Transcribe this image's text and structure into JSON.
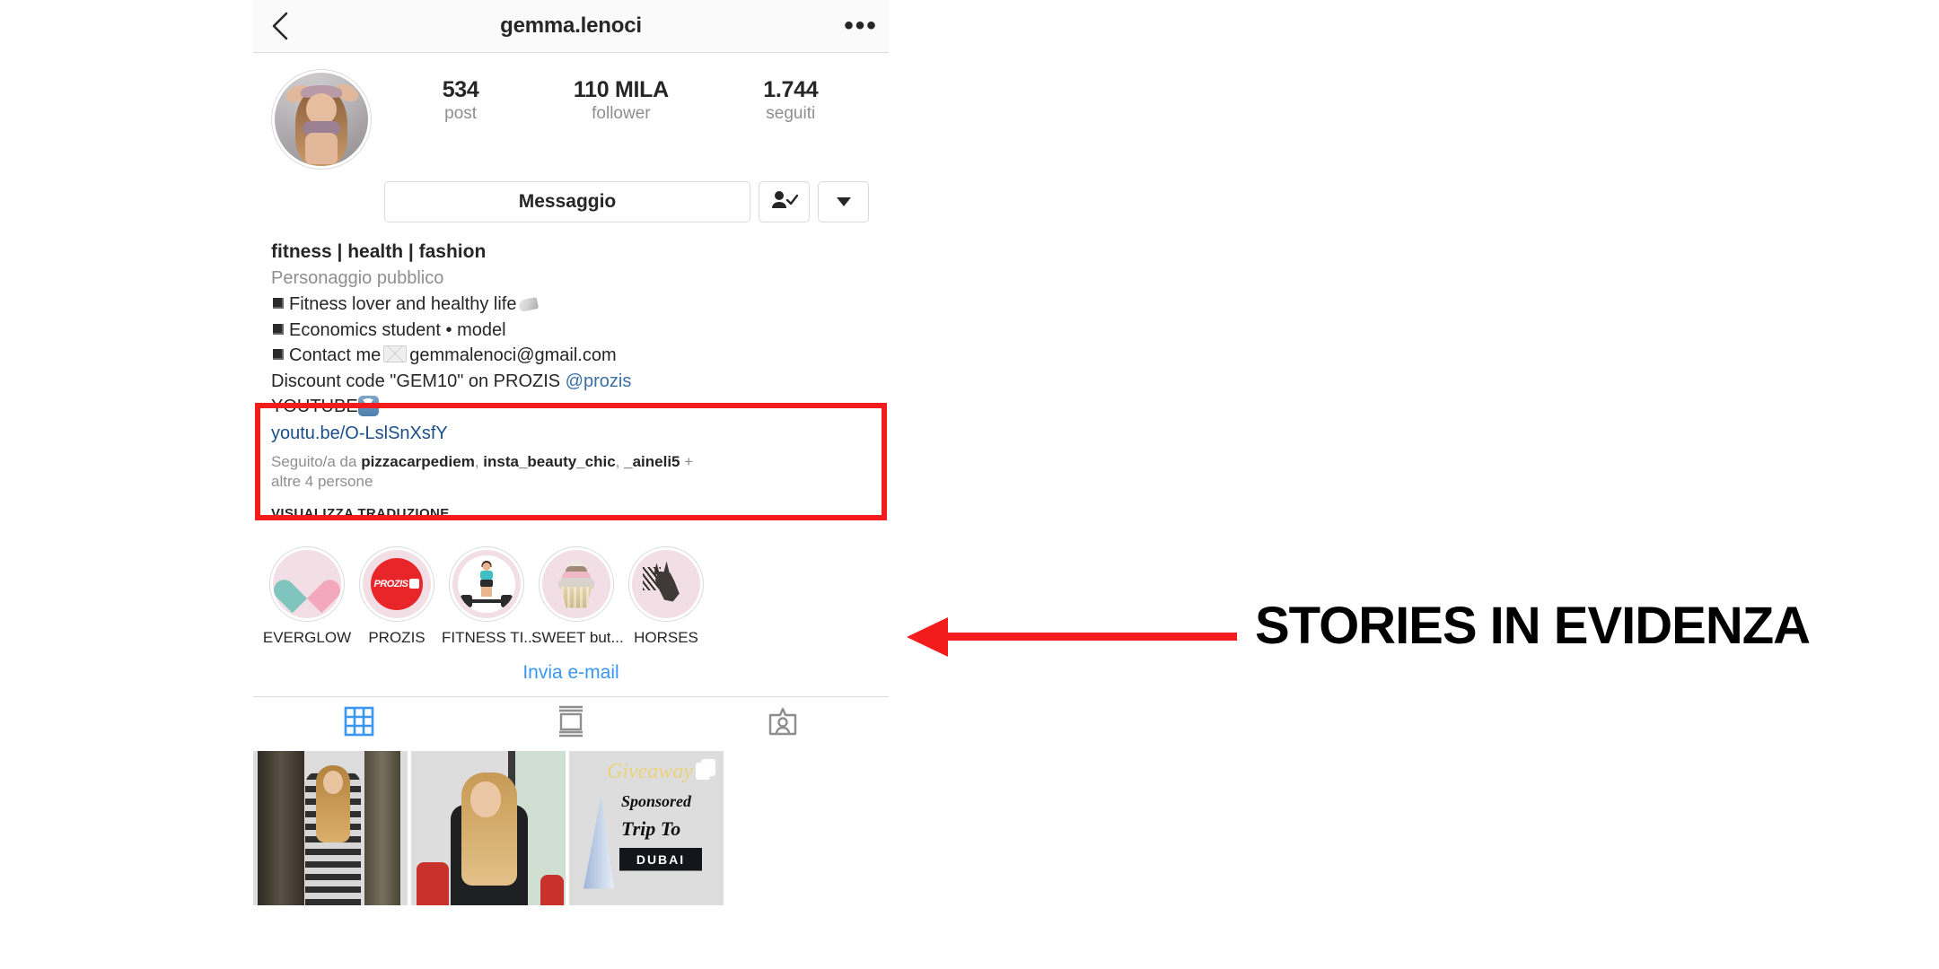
{
  "header": {
    "back_icon": "chevron-left-icon",
    "username": "gemma.lenoci",
    "more_icon": "ellipsis-icon",
    "more_glyph": "•••"
  },
  "profile": {
    "avatar_alt": "profile-photo",
    "stats": [
      {
        "value": "534",
        "label": "post"
      },
      {
        "value": "110 MILA",
        "label": "follower"
      },
      {
        "value": "1.744",
        "label": "seguiti"
      }
    ],
    "actions": {
      "message_label": "Messaggio",
      "following_icon": "person-check-icon",
      "dropdown_icon": "chevron-down-icon"
    }
  },
  "bio": {
    "name": "fitness | health | fashion",
    "category": "Personaggio pubblico",
    "lines": [
      {
        "bullet": true,
        "text": "Fitness lover and healthy life",
        "emoji": "shoe-emoji"
      },
      {
        "bullet": true,
        "text": "Economics student • model",
        "emoji": ""
      },
      {
        "bullet": true,
        "text": "Contact me",
        "emoji": "envelope-emoji",
        "after": "gemmalenoci@gmail.com"
      }
    ],
    "discount_text": "Discount code \"GEM10\" on PROZIS ",
    "discount_mention": "@prozis",
    "youtube_text": "YOUTUBE",
    "youtube_emoji": "arrow-down-emoji",
    "link": "youtu.be/O-LslSnXsfY"
  },
  "followed_by": {
    "prefix": "Seguito/a da ",
    "users": [
      "pizzacarpediem",
      "insta_beauty_chic",
      "_aineli5"
    ],
    "suffix": " + altre 4 persone"
  },
  "translate_label": "VISUALIZZA TRADUZIONE",
  "highlights": [
    {
      "label": "EVERGLOW",
      "icon": "heart-icon"
    },
    {
      "label": "PROZIS",
      "icon": "prozis-logo-icon",
      "logo_text": "PROZIS"
    },
    {
      "label": "FITNESS TI...",
      "icon": "weightlifter-icon"
    },
    {
      "label": "SWEET but...",
      "icon": "cupcake-icon"
    },
    {
      "label": "HORSES",
      "icon": "horse-icon"
    }
  ],
  "email_link_label": "Invia e-mail",
  "tabs": [
    {
      "name": "grid",
      "icon": "grid-icon",
      "active": true
    },
    {
      "name": "reels",
      "icon": "feed-icon",
      "active": false
    },
    {
      "name": "tagged",
      "icon": "tagged-icon",
      "active": false
    }
  ],
  "posts": [
    {
      "alt": "girl-by-tree-post"
    },
    {
      "alt": "girl-eating-icecream-post"
    },
    {
      "alt": "dubai-giveaway-post",
      "title1": "Giveaway",
      "title2": "Sponsored",
      "title3": "Trip To",
      "title4": "DUBAI",
      "multi": true
    }
  ],
  "annotation": {
    "text": "STORIES IN EVIDENZA",
    "color": "#f21c1c",
    "arrow_icon": "left-arrow-annotation"
  }
}
